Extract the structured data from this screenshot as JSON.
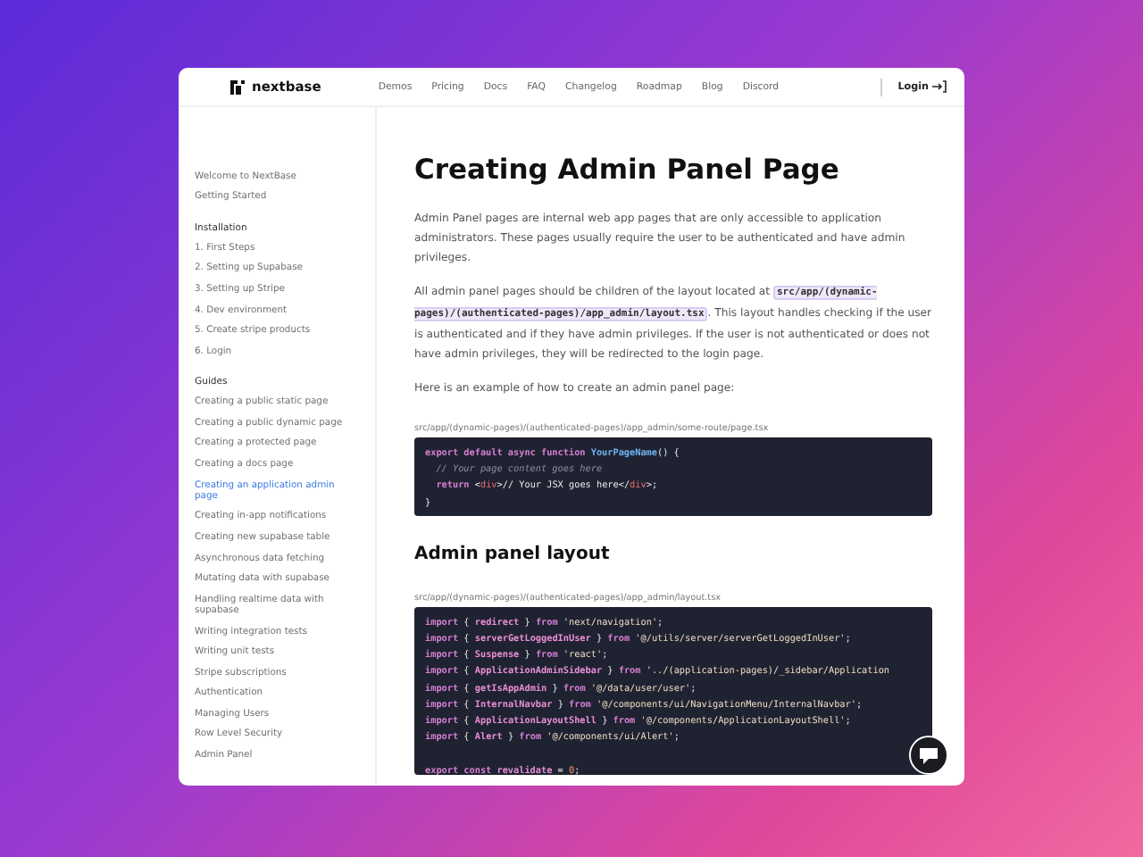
{
  "header": {
    "brand": "nextbase",
    "nav": [
      "Demos",
      "Pricing",
      "Docs",
      "FAQ",
      "Changelog",
      "Roadmap",
      "Blog",
      "Discord"
    ],
    "login": "Login"
  },
  "sidebar": {
    "top": [
      {
        "label": "Welcome to NextBase",
        "selected": false
      },
      {
        "label": "Getting Started",
        "selected": false
      }
    ],
    "sections": [
      {
        "title": "Installation",
        "items": [
          {
            "label": "1. First Steps",
            "selected": false
          },
          {
            "label": "2. Setting up Supabase",
            "selected": false
          },
          {
            "label": "3. Setting up Stripe",
            "selected": false
          },
          {
            "label": "4. Dev environment",
            "selected": false
          },
          {
            "label": "5. Create stripe products",
            "selected": false
          },
          {
            "label": "6. Login",
            "selected": false
          }
        ]
      },
      {
        "title": "Guides",
        "items": [
          {
            "label": "Creating a public static page",
            "selected": false
          },
          {
            "label": "Creating a public dynamic page",
            "selected": false
          },
          {
            "label": "Creating a protected page",
            "selected": false
          },
          {
            "label": "Creating a docs page",
            "selected": false
          },
          {
            "label": "Creating an application admin page",
            "selected": true
          },
          {
            "label": "Creating in-app notifications",
            "selected": false
          },
          {
            "label": "Creating new supabase table",
            "selected": false
          },
          {
            "label": "Asynchronous data fetching",
            "selected": false
          },
          {
            "label": "Mutating data with supabase",
            "selected": false
          },
          {
            "label": "Handling realtime data with supabase",
            "selected": false
          },
          {
            "label": "Writing integration tests",
            "selected": false
          },
          {
            "label": "Writing unit tests",
            "selected": false
          },
          {
            "label": "Stripe subscriptions",
            "selected": false
          },
          {
            "label": "Authentication",
            "selected": false
          },
          {
            "label": "Managing Users",
            "selected": false
          },
          {
            "label": "Row Level Security",
            "selected": false
          },
          {
            "label": "Admin Panel",
            "selected": false
          }
        ]
      }
    ]
  },
  "content": [
    {
      "kind": "h1",
      "text": "Creating Admin Panel Page"
    },
    {
      "kind": "p",
      "parts": [
        {
          "text": "Admin Panel pages are internal web app pages that are only accessible to application administrators. These pages usually require the user to be authenticated and have admin privileges."
        }
      ]
    },
    {
      "kind": "p",
      "parts": [
        {
          "text": "All admin panel pages should be children of the layout located at "
        },
        {
          "code": "src/app/(dynamic-pages)/(authenticated-pages)/app_admin/layout.tsx"
        },
        {
          "text": ". This layout handles checking if the user is authenticated and if they have admin privileges. If the user is not authenticated or does not have admin privileges, they will be redirected to the login page."
        }
      ]
    },
    {
      "kind": "p",
      "parts": [
        {
          "text": "Here is an example of how to create an admin panel page:"
        }
      ]
    },
    {
      "kind": "code",
      "file": "src/app/(dynamic-pages)/(authenticated-pages)/app_admin/some-route/page.tsx",
      "lines": [
        {
          "kind": "code",
          "tokens": [
            {
              "kind": "kw",
              "s": "export default async function "
            },
            {
              "kind": "fn",
              "s": "YourPageName"
            },
            {
              "kind": "pl",
              "s": "() {"
            }
          ]
        },
        {
          "kind": "code",
          "tokens": [
            {
              "kind": "cm",
              "s": "  // Your page content goes here"
            }
          ]
        },
        {
          "kind": "code",
          "tokens": [
            {
              "kind": "kw",
              "s": "  return "
            },
            {
              "kind": "pl",
              "s": "<"
            },
            {
              "kind": "tag",
              "s": "div"
            },
            {
              "kind": "pl",
              "s": ">// Your JSX goes here</"
            },
            {
              "kind": "tag",
              "s": "div"
            },
            {
              "kind": "pl",
              "s": ">;"
            }
          ]
        },
        {
          "kind": "code",
          "tokens": [
            {
              "kind": "pl",
              "s": "}"
            }
          ]
        }
      ]
    },
    {
      "kind": "h2",
      "text": "Admin panel layout"
    },
    {
      "kind": "code",
      "file": "src/app/(dynamic-pages)/(authenticated-pages)/app_admin/layout.tsx",
      "lines": [
        {
          "kind": "code",
          "tokens": [
            {
              "kind": "kw",
              "s": "import "
            },
            {
              "kind": "pl",
              "s": "{ "
            },
            {
              "kind": "var",
              "s": "redirect"
            },
            {
              "kind": "pl",
              "s": " } "
            },
            {
              "kind": "kw",
              "s": "from "
            },
            {
              "kind": "str",
              "s": "'next/navigation'"
            },
            {
              "kind": "pl",
              "s": ";"
            }
          ]
        },
        {
          "kind": "code",
          "tokens": [
            {
              "kind": "kw",
              "s": "import "
            },
            {
              "kind": "pl",
              "s": "{ "
            },
            {
              "kind": "var",
              "s": "serverGetLoggedInUser"
            },
            {
              "kind": "pl",
              "s": " } "
            },
            {
              "kind": "kw",
              "s": "from "
            },
            {
              "kind": "str",
              "s": "'@/utils/server/serverGetLoggedInUser'"
            },
            {
              "kind": "pl",
              "s": ";"
            }
          ]
        },
        {
          "kind": "code",
          "tokens": [
            {
              "kind": "kw",
              "s": "import "
            },
            {
              "kind": "pl",
              "s": "{ "
            },
            {
              "kind": "var",
              "s": "Suspense"
            },
            {
              "kind": "pl",
              "s": " } "
            },
            {
              "kind": "kw",
              "s": "from "
            },
            {
              "kind": "str",
              "s": "'react'"
            },
            {
              "kind": "pl",
              "s": ";"
            }
          ]
        },
        {
          "kind": "code",
          "tokens": [
            {
              "kind": "kw",
              "s": "import "
            },
            {
              "kind": "pl",
              "s": "{ "
            },
            {
              "kind": "var",
              "s": "ApplicationAdminSidebar"
            },
            {
              "kind": "pl",
              "s": " } "
            },
            {
              "kind": "kw",
              "s": "from "
            },
            {
              "kind": "str",
              "s": "'../(application-pages)/_sidebar/Application"
            }
          ]
        },
        {
          "kind": "code",
          "tokens": [
            {
              "kind": "kw",
              "s": "import "
            },
            {
              "kind": "pl",
              "s": "{ "
            },
            {
              "kind": "var",
              "s": "getIsAppAdmin"
            },
            {
              "kind": "pl",
              "s": " } "
            },
            {
              "kind": "kw",
              "s": "from "
            },
            {
              "kind": "str",
              "s": "'@/data/user/user'"
            },
            {
              "kind": "pl",
              "s": ";"
            }
          ]
        },
        {
          "kind": "code",
          "tokens": [
            {
              "kind": "kw",
              "s": "import "
            },
            {
              "kind": "pl",
              "s": "{ "
            },
            {
              "kind": "var",
              "s": "InternalNavbar"
            },
            {
              "kind": "pl",
              "s": " } "
            },
            {
              "kind": "kw",
              "s": "from "
            },
            {
              "kind": "str",
              "s": "'@/components/ui/NavigationMenu/InternalNavbar'"
            },
            {
              "kind": "pl",
              "s": ";"
            }
          ]
        },
        {
          "kind": "code",
          "tokens": [
            {
              "kind": "kw",
              "s": "import "
            },
            {
              "kind": "pl",
              "s": "{ "
            },
            {
              "kind": "var",
              "s": "ApplicationLayoutShell"
            },
            {
              "kind": "pl",
              "s": " } "
            },
            {
              "kind": "kw",
              "s": "from "
            },
            {
              "kind": "str",
              "s": "'@/components/ApplicationLayoutShell'"
            },
            {
              "kind": "pl",
              "s": ";"
            }
          ]
        },
        {
          "kind": "code",
          "tokens": [
            {
              "kind": "kw",
              "s": "import "
            },
            {
              "kind": "pl",
              "s": "{ "
            },
            {
              "kind": "var",
              "s": "Alert"
            },
            {
              "kind": "pl",
              "s": " } "
            },
            {
              "kind": "kw",
              "s": "from "
            },
            {
              "kind": "str",
              "s": "'@/components/ui/Alert'"
            },
            {
              "kind": "pl",
              "s": ";"
            }
          ]
        },
        {
          "kind": "blank"
        },
        {
          "kind": "code",
          "tokens": [
            {
              "kind": "kw",
              "s": "export const "
            },
            {
              "kind": "var",
              "s": "revalidate"
            },
            {
              "kind": "pl",
              "s": " = "
            },
            {
              "kind": "num",
              "s": "0"
            },
            {
              "kind": "pl",
              "s": ";"
            }
          ]
        }
      ]
    }
  ]
}
